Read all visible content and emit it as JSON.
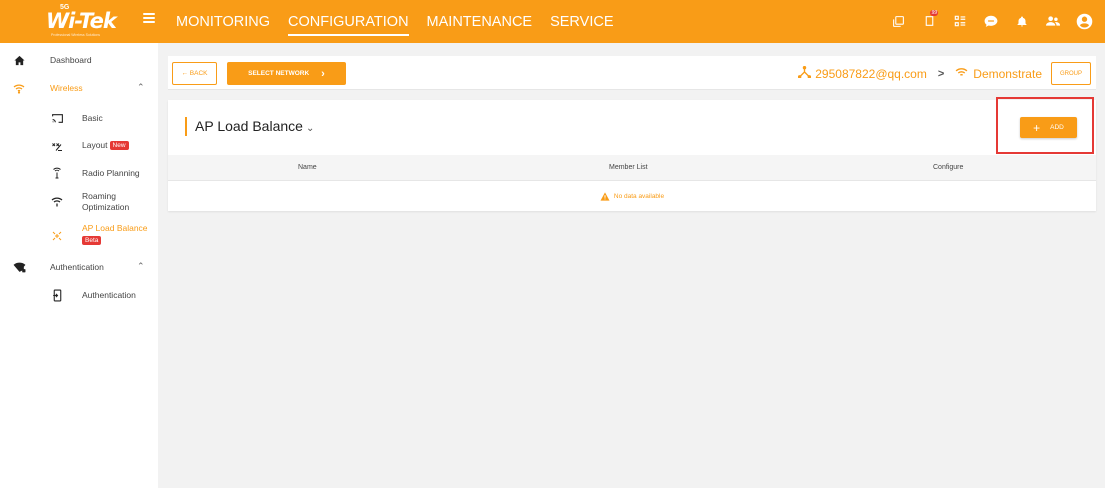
{
  "brand": {
    "logo_text": "Wi-Tek",
    "logo_sup": "5G",
    "tagline": "Professional Wireless Solutions"
  },
  "nav": [
    "MONITORING",
    "CONFIGURATION",
    "MAINTENANCE",
    "SERVICE"
  ],
  "nav_active_index": 1,
  "top_icons": [
    "copy-icon",
    "notification-cart-icon",
    "apps-icon",
    "chat-icon",
    "bell-icon",
    "users-icon",
    "account-icon"
  ],
  "sidebar": {
    "dashboard": "Dashboard",
    "wireless_group": "Wireless",
    "items": {
      "basic": "Basic",
      "layout": "Layout",
      "layout_badge": "New",
      "radio_planning": "Radio Planning",
      "roaming_1": "Roaming",
      "roaming_2": "Optimization",
      "ap_load_balance": "AP Load Balance",
      "ap_load_badge": "Beta"
    },
    "auth_group": "Authentication",
    "auth_item": "Authentication"
  },
  "network_bar": {
    "back_label": "BACK",
    "select_label": "SELECT NETWORK",
    "account": "295087822@qq.com",
    "site": "Demonstrate",
    "group_label": "GROUP"
  },
  "card": {
    "title": "AP Load Balance",
    "add_label": "ADD",
    "columns": [
      "Name",
      "Member List",
      "Configure"
    ],
    "empty_text": "No data available"
  },
  "colors": {
    "accent": "#f99c17",
    "highlight": "#e53935"
  }
}
